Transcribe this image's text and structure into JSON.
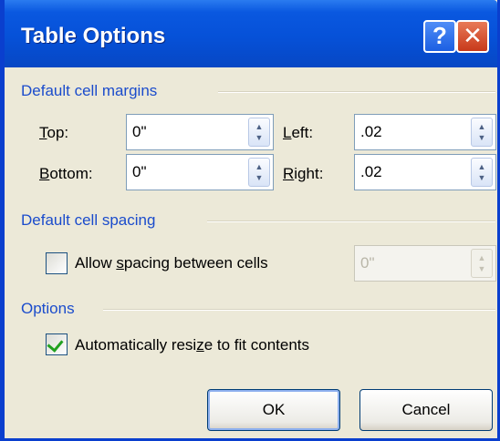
{
  "window": {
    "title": "Table Options",
    "help_glyph": "?",
    "close_glyph": "✕"
  },
  "margins": {
    "group_label": "Default cell margins",
    "top": {
      "label_access_key": "T",
      "label_rest": "op:",
      "value": "0\""
    },
    "bottom": {
      "label_access_key": "B",
      "label_rest": "ottom:",
      "value": "0\""
    },
    "left": {
      "label_access_key": "L",
      "label_rest": "eft:",
      "value": ".02"
    },
    "right": {
      "label_access_key": "R",
      "label_rest": "ight:",
      "value": ".02"
    }
  },
  "spacing": {
    "group_label": "Default cell spacing",
    "checkbox_label_pre": "Allow ",
    "checkbox_label_access_key": "s",
    "checkbox_label_post": "pacing between cells",
    "checked": false,
    "value": "0\""
  },
  "options": {
    "group_label": "Options",
    "checkbox_label_pre": "Automatically resi",
    "checkbox_label_access_key": "z",
    "checkbox_label_post": "e to fit contents",
    "checked": true
  },
  "buttons": {
    "ok": "OK",
    "cancel": "Cancel"
  },
  "colors": {
    "titlebar": "#0651d8",
    "group_label": "#1b4ccc",
    "checkmark": "#21a121",
    "dialog_bg": "#ece9d8"
  }
}
